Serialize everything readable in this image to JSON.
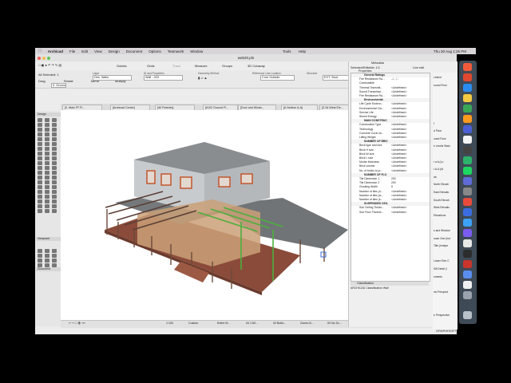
{
  "menubar": {
    "app": "Archicad",
    "items": [
      "File",
      "Edit",
      "View",
      "Design",
      "Document",
      "Options",
      "Teamwork",
      "Window"
    ],
    "center_items": [
      "Tools",
      "Help"
    ],
    "clock": "Thu 20 Aug  1:25 PM"
  },
  "window": {
    "title": "web20.pln"
  },
  "toolbar1": {
    "tools": [
      "Guides",
      "Grids",
      "Trace",
      "Measure",
      "Groups",
      "3D Cutaway"
    ]
  },
  "toolbar2": {
    "drag": "Drag",
    "rotate": "Rotate",
    "mirror": "Mirror",
    "multiply": "Multiply",
    "layer_label": "Layer",
    "layer_value": "Des. Walls",
    "id_label": "ID and Properties",
    "id_value": "Wall - 003",
    "geo_label": "Geometry Method",
    "refline_label": "Reference Line Location",
    "refline_value": "Core Outside",
    "structure_label": "Structure",
    "structure_value": "EXT. Stud",
    "floor_value": "0. Ground Fl.",
    "selected_label": "All Selected: 1",
    "live_edit": "Live edit"
  },
  "tabs": [
    "[0. Main FF Fl...",
    "[Archicad Center]",
    "[All Finishes]",
    "[#102 Ground Fl...",
    "[Door and Windo...",
    "[A Section A-A]",
    "[Z-34 West Ele..."
  ],
  "toolbox": {
    "design_header": "Design",
    "viewpoint_header": "Viewpoint",
    "document_header": "Document"
  },
  "status": {
    "scale": "1:100",
    "view": "Custom",
    "items": [
      "Entire M...",
      "04 1:50...",
      "03 Build...",
      "Zones-N...",
      "00 No Sc...",
      "Main Mo...",
      "Detailed..."
    ],
    "settings": "Settings..."
  },
  "properties": {
    "panel_title": "Metadata",
    "selected_editable": "Selected/Editable: 1/1",
    "tab": "Properties",
    "rows": [
      {
        "type": "hdr",
        "name": "General Ratings"
      },
      {
        "name": "Fire Resistance Ra...",
        "value": "--/ - / -"
      },
      {
        "name": "Combustible",
        "value": ""
      },
      {
        "name": "Thermal Transmit...",
        "value": "<Undefined>"
      },
      {
        "name": "Sound Transmissi...",
        "value": "<Undefined>"
      },
      {
        "name": "Fire Resistance Ra...",
        "value": "<Undefined>"
      },
      {
        "type": "hdr",
        "name": "Environmental"
      },
      {
        "name": "Life Cycle Environ...",
        "value": "<Undefined>"
      },
      {
        "name": "Environmental Cla...",
        "value": "<Undefined>"
      },
      {
        "name": "Service Life",
        "value": "<Undefined>"
      },
      {
        "name": "Stored Energy",
        "value": "<Undefined>"
      },
      {
        "type": "hdr",
        "name": "MAIN CONSTRUC"
      },
      {
        "name": "Construction Type",
        "value": "<Undefined>"
      },
      {
        "name": "Technology",
        "value": "<Undefined>"
      },
      {
        "name": "Concrete Cover at...",
        "value": "<Undefined>"
      },
      {
        "name": "Lifting Weight",
        "value": "<Undefined>"
      },
      {
        "type": "hdr",
        "name": "NUMBER OF BRIC"
      },
      {
        "name": "Brick type and size",
        "value": "<Undefined>"
      },
      {
        "name": "Brick H size",
        "value": "<Undefined>"
      },
      {
        "name": "Brick W size",
        "value": "<Undefined>"
      },
      {
        "name": "Brick L size",
        "value": "<Undefined>"
      },
      {
        "name": "Mortar thickness",
        "value": "<Undefined>"
      },
      {
        "name": "Brick volume",
        "value": "<Undefined>"
      },
      {
        "name": "No. of bricks to pr...",
        "value": "<Undefined>"
      },
      {
        "type": "hdr",
        "name": "NUMBER OF FLO"
      },
      {
        "name": "Tile Dimension 1",
        "value": "200"
      },
      {
        "name": "Tile Dimension 2",
        "value": "200"
      },
      {
        "name": "Grouting Width",
        "value": "5"
      },
      {
        "name": "Number of tiles (n...",
        "value": "<Undefined>"
      },
      {
        "name": "Number of tiles (w...",
        "value": "<Undefined>"
      },
      {
        "name": "Number of tiles (s...",
        "value": "<Undefined>"
      },
      {
        "type": "hdr",
        "name": "SUSPENDED CEIL"
      },
      {
        "name": "Sub Ceiling Thickn...",
        "value": "<Undefined>"
      },
      {
        "name": "Sub Floor Thickne...",
        "value": "<Undefined>"
      }
    ],
    "classification_header": "Classification",
    "classification_value": "ARCHICAD Classification Wall"
  },
  "sidepanel": {
    "items": [
      "Linked",
      "round Floor",
      "",
      "",
      "",
      "",
      "f",
      "d Floor",
      "ound Floor",
      "e Levels Statu",
      "",
      "r a A (Lo",
      "r A-A (Ai",
      "ab",
      "North Elevati",
      "East Elevatio",
      "South Elevati",
      "West Elevatio",
      "Elevations",
      "",
      "s and Window",
      "ouse One (Ind",
      "Title (Indepe",
      "",
      "Lower Elev C",
      "Sill Detail (I",
      "ements",
      "",
      "nic Perspect",
      "",
      "",
      "e Perspective"
    ]
  },
  "footer": {
    "brand": "GRAPHISOFT"
  },
  "colors": {
    "roof": "#75797c",
    "siding": "#c8cbce",
    "window_frame": "#c2562e",
    "deck": "#8b4b3a",
    "beam_selected": "#4caf3c",
    "column": "#6b4a3a"
  }
}
